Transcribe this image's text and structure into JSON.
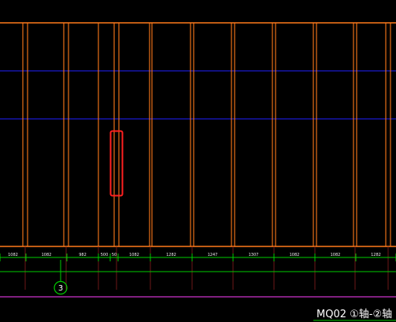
{
  "colors": {
    "background": "#000000",
    "frame": "#ff7a1a",
    "mullion": "#ff7a1a",
    "transom": "#2020ff",
    "dimension": "#00cc00",
    "dim_text": "#f3f3f3",
    "selection": "#ff2020",
    "magenta_line": "#cc33cc",
    "title_underline": "#00cc00"
  },
  "dimensions": [
    "1082",
    "1082",
    "982",
    "500",
    "50",
    "1082",
    "1282",
    "1247",
    "1307",
    "1082",
    "1082",
    "1282"
  ],
  "axis_marker": {
    "label": "3"
  },
  "drawing_title": {
    "text": "MQ02 ①轴-②轴"
  }
}
